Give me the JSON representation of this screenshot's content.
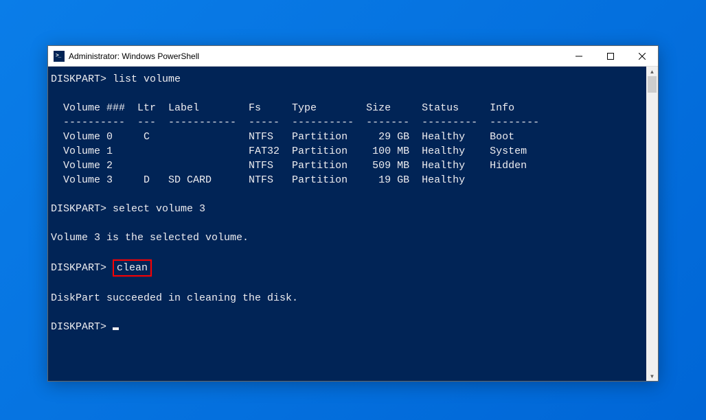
{
  "window": {
    "title": "Administrator: Windows PowerShell"
  },
  "prompts": {
    "p1": "DISKPART>",
    "cmd1": "list volume",
    "p2": "DISKPART>",
    "cmd2": "select volume 3",
    "p3": "DISKPART>",
    "cmd3": "clean",
    "p4": "DISKPART>"
  },
  "table": {
    "header": "  Volume ###  Ltr  Label        Fs     Type        Size     Status     Info",
    "divider": "  ----------  ---  -----------  -----  ----------  -------  ---------  --------",
    "rows": [
      "  Volume 0     C                NTFS   Partition     29 GB  Healthy    Boot",
      "  Volume 1                      FAT32  Partition    100 MB  Healthy    System",
      "  Volume 2                      NTFS   Partition    509 MB  Healthy    Hidden",
      "  Volume 3     D   SD CARD      NTFS   Partition     19 GB  Healthy"
    ]
  },
  "messages": {
    "selected": "Volume 3 is the selected volume.",
    "cleaned": "DiskPart succeeded in cleaning the disk."
  }
}
